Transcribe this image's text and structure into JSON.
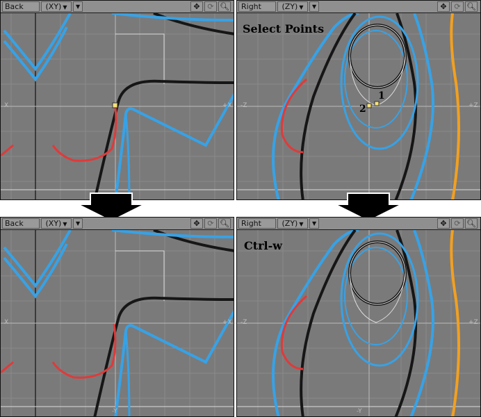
{
  "left_view": {
    "view_label": "Back",
    "projection_label": "(XY)",
    "axis_left": "X",
    "axis_right": "+X",
    "axis_bottom": "-Y"
  },
  "right_view": {
    "view_label": "Right",
    "projection_label": "(ZY)",
    "axis_left": "-Z",
    "axis_right": "+Z",
    "axis_bottom": "-Y"
  },
  "captions": {
    "top_right": "Select Points",
    "bottom_right": "Ctrl-w"
  },
  "point_labels": {
    "first": "1",
    "second": "2"
  },
  "toolbar_icons": [
    "move-icon",
    "rotate-icon",
    "zoom-icon",
    "dropdown-arrow-icon"
  ],
  "colors": {
    "viewport_bg": "#7a7a7a",
    "blue_curve": "#37a2e6",
    "black_curve": "#161616",
    "red_curve": "#e03a3a",
    "orange_curve": "#f2a020",
    "selected_point": "#f6e27a"
  }
}
